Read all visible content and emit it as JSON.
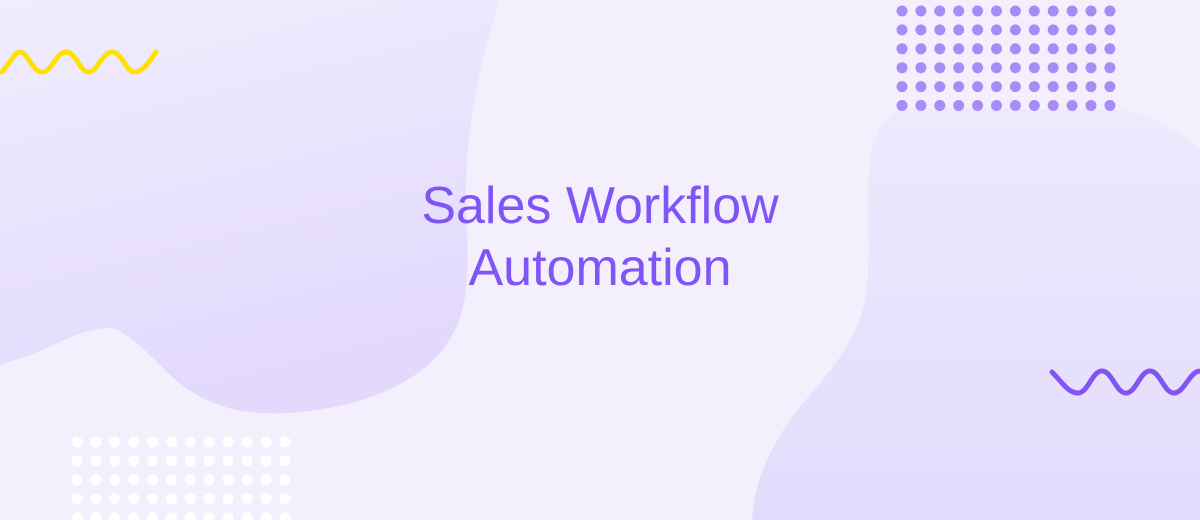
{
  "hero": {
    "title_line1": "Sales Workflow",
    "title_line2": "Automation"
  },
  "colors": {
    "background": "#f3effd",
    "blob": "#e4dcfd",
    "title": "#8155f5",
    "dots_top_right": "#a88bf7",
    "dots_bottom_left": "#ffffff",
    "wave_yellow": "#ffe000",
    "wave_purple": "#8155f5"
  },
  "decor": {
    "dot_grid_top_right": {
      "cols": 12,
      "rows": 6
    },
    "dot_grid_bottom_left": {
      "cols": 12,
      "rows": 5
    }
  }
}
